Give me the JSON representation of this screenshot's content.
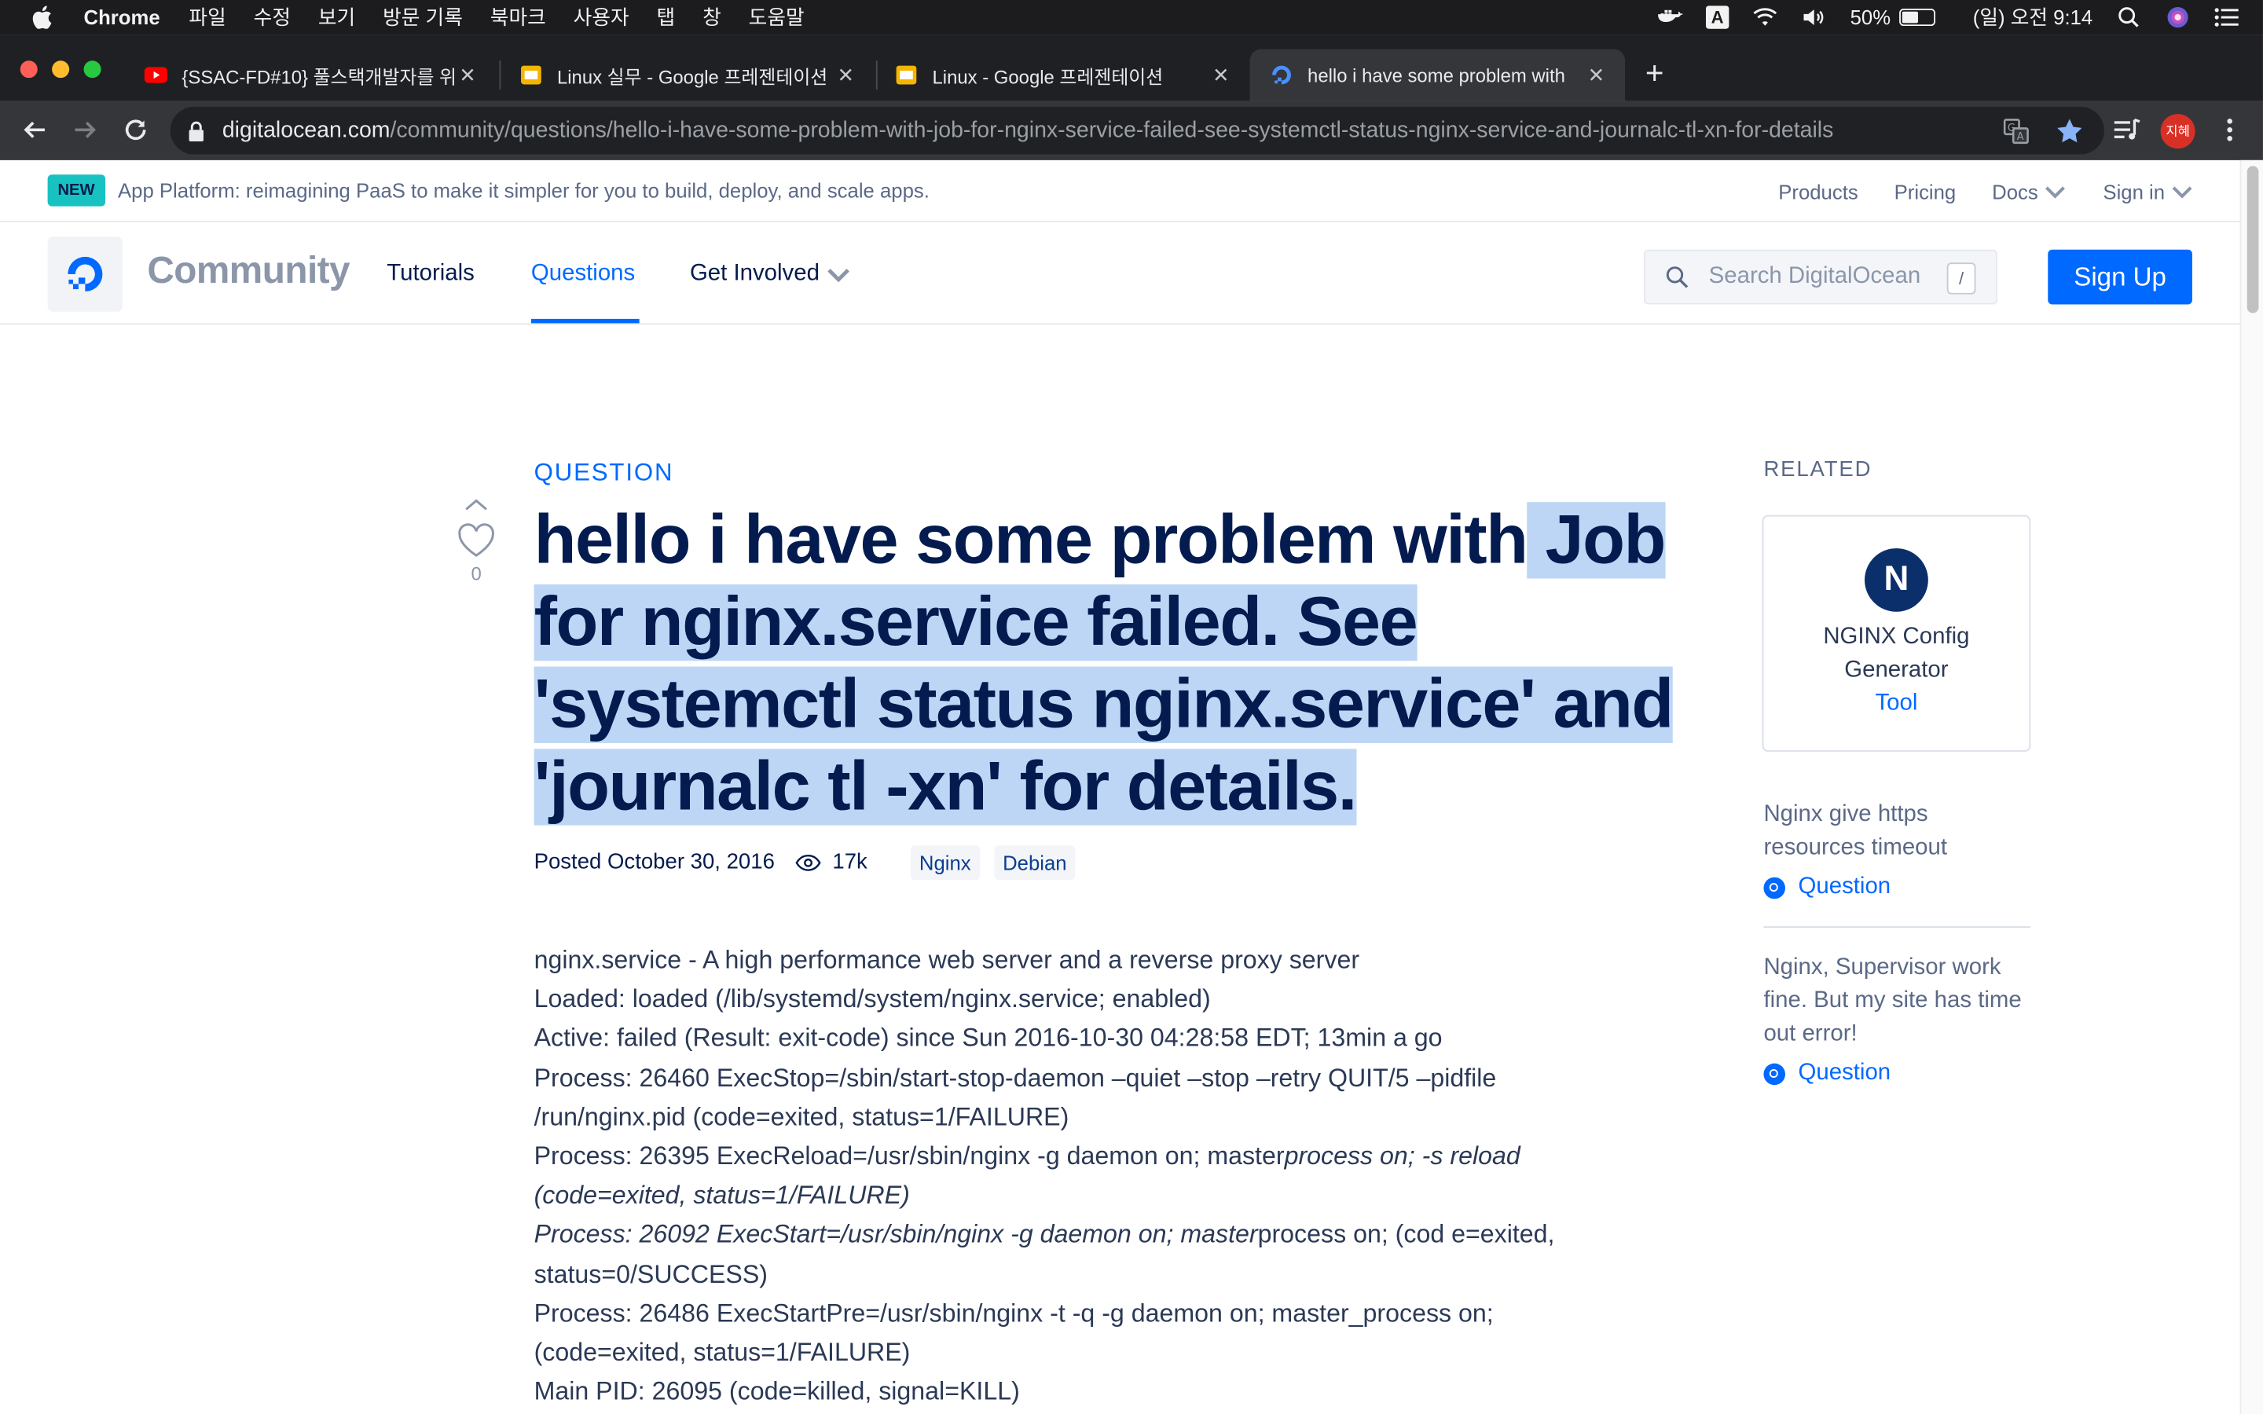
{
  "menubar": {
    "app_name": "Chrome",
    "items": [
      "파일",
      "수정",
      "보기",
      "방문 기록",
      "북마크",
      "사용자",
      "탭",
      "창",
      "도움말"
    ],
    "battery_percent": "50%",
    "battery_level": 0.5,
    "clock": "(일) 오전 9:14",
    "input_source": "A"
  },
  "tabs": [
    {
      "title": "{SSAC-FD#10} 풀스택개발자를 위",
      "favicon": "youtube-icon",
      "active": false
    },
    {
      "title": "Linux 실무 - Google 프레젠테이션",
      "favicon": "google-slides-icon",
      "active": false
    },
    {
      "title": "Linux - Google 프레젠테이션",
      "favicon": "google-slides-icon",
      "active": false
    },
    {
      "title": "hello i have some problem with",
      "favicon": "digitalocean-icon",
      "active": true
    }
  ],
  "address_bar": {
    "domain": "digitalocean.com",
    "path": "/community/questions/hello-i-have-some-problem-with-job-for-nginx-service-failed-see-systemctl-status-nginx-service-and-journalc-tl-xn-for-details"
  },
  "profile": {
    "avatar_text": "지혜"
  },
  "promo": {
    "badge": "NEW",
    "message": "App Platform: reimagining PaaS to make it simpler for you to build, deploy, and scale apps.",
    "links": {
      "products": "Products",
      "pricing": "Pricing",
      "docs": "Docs",
      "sign_in": "Sign in"
    }
  },
  "nav": {
    "brand": "Community",
    "tutorials": "Tutorials",
    "questions": "Questions",
    "get_involved": "Get Involved",
    "search_placeholder": "Search DigitalOcean",
    "search_shortcut": "/",
    "sign_up": "Sign Up"
  },
  "question": {
    "label": "QUESTION",
    "votes": "0",
    "title_plain": "hello i have some problem with",
    "title_highlighted": " Job for nginx.service failed. See 'systemctl status nginx.service' and 'journalc tl -xn' for details.",
    "posted": "Posted October 30, 2016",
    "views": "17k",
    "tags": [
      "Nginx",
      "Debian"
    ],
    "body": {
      "l1": "nginx.service - A high performance web server and a reverse proxy server",
      "l2": "Loaded: loaded (/lib/systemd/system/nginx.service; enabled)",
      "l3": "Active: failed (Result: exit-code) since Sun 2016-10-30 04:28:58 EDT; 13min a go",
      "l4": "Process: 26460 ExecStop=/sbin/start-stop-daemon –quiet –stop –retry QUIT/5 –pidfile /run/nginx.pid (code=exited, status=1/FAILURE)",
      "l5a": "Process: 26395 ExecReload=/usr/sbin/nginx -g daemon on; master",
      "l5b": "process on; -s reload (code=exited, status=1/FAILURE)",
      "l6a": "Process: 26092 ExecStart=/usr/sbin/nginx -g daemon on; master",
      "l6b": "process on; (cod e=exited, status=0/SUCCESS)",
      "l7": "Process: 26486 ExecStartPre=/usr/sbin/nginx -t -q -g daemon on; master_process on; (code=exited, status=1/FAILURE)",
      "l8": "Main PID: 26095 (code=killed, signal=KILL)"
    }
  },
  "related": {
    "label": "RELATED",
    "card": {
      "logo_letter": "N",
      "name": "NGINX Config Generator",
      "link": "Tool"
    },
    "items": [
      {
        "title": "Nginx give https resources timeout",
        "kind": "Question"
      },
      {
        "title": "Nginx, Supervisor work fine. But my site has time out error!",
        "kind": "Question"
      }
    ]
  },
  "colors": {
    "accent": "#0069ff",
    "navy": "#031b4e",
    "highlight": "#bdd6f5",
    "badge": "#17c2c1"
  }
}
